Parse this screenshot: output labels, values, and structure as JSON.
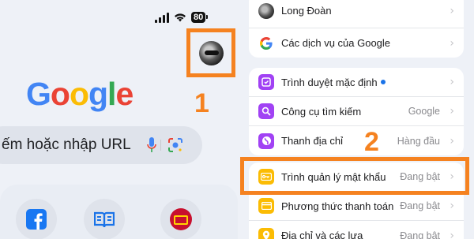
{
  "left": {
    "battery": "80",
    "logo_letters": [
      {
        "ch": "G",
        "color": "#4285F4"
      },
      {
        "ch": "o",
        "color": "#EA4335"
      },
      {
        "ch": "o",
        "color": "#FBBC05"
      },
      {
        "ch": "g",
        "color": "#4285F4"
      },
      {
        "ch": "l",
        "color": "#34A853"
      },
      {
        "ch": "e",
        "color": "#EA4335"
      }
    ],
    "search_text": "ếm hoặc nhập URL",
    "annotation_1": "1"
  },
  "right": {
    "account_rows": [
      {
        "label": "Long Đoàn",
        "icon": "avatar-icon"
      },
      {
        "label": "Các dịch vụ của Google",
        "icon": "google-g-icon"
      }
    ],
    "settings_rows": [
      {
        "label": "Trình duyệt mặc định",
        "value": "",
        "icon": "default-browser-icon",
        "color": "#a142f4"
      },
      {
        "label": "Công cụ tìm kiếm",
        "value": "Google",
        "icon": "search-icon",
        "color": "#a142f4"
      },
      {
        "label": "Thanh địa chỉ",
        "value": "Hàng đầu",
        "icon": "globe-icon",
        "color": "#a142f4"
      }
    ],
    "autofill_rows": [
      {
        "label": "Trình quản lý mật khẩu",
        "value": "Đang bật",
        "icon": "key-icon",
        "color": "#fbbc04"
      },
      {
        "label": "Phương thức thanh toán",
        "value": "Đang bật",
        "icon": "card-icon",
        "color": "#fbbc04"
      },
      {
        "label": "Địa chỉ và các lựa",
        "value": "Đang bật",
        "icon": "location-icon",
        "color": "#fbbc04"
      }
    ],
    "annotation_2": "2"
  },
  "colors": {
    "accent_orange": "#f58220",
    "purple": "#a142f4",
    "yellow": "#fbbc04"
  }
}
